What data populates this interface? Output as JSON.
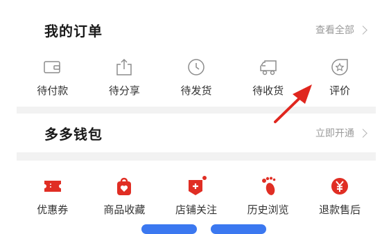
{
  "orders": {
    "title": "我的订单",
    "more": "查看全部",
    "items": [
      {
        "label": "待付款",
        "icon": "wallet-icon"
      },
      {
        "label": "待分享",
        "icon": "share-icon"
      },
      {
        "label": "待发货",
        "icon": "clock-icon"
      },
      {
        "label": "待收货",
        "icon": "truck-icon"
      },
      {
        "label": "评价",
        "icon": "review-icon"
      }
    ]
  },
  "wallet": {
    "title": "多多钱包",
    "more": "立即开通"
  },
  "tools": {
    "items": [
      {
        "label": "优惠券",
        "icon": "coupon-icon"
      },
      {
        "label": "商品收藏",
        "icon": "favorite-bag-icon"
      },
      {
        "label": "店铺关注",
        "icon": "store-follow-icon"
      },
      {
        "label": "历史浏览",
        "icon": "footprint-icon"
      },
      {
        "label": "退款售后",
        "icon": "refund-icon"
      }
    ]
  },
  "colors": {
    "accent": "#e02e24",
    "muted": "#9a9a9a",
    "icon_gray": "#8c8c8c"
  }
}
